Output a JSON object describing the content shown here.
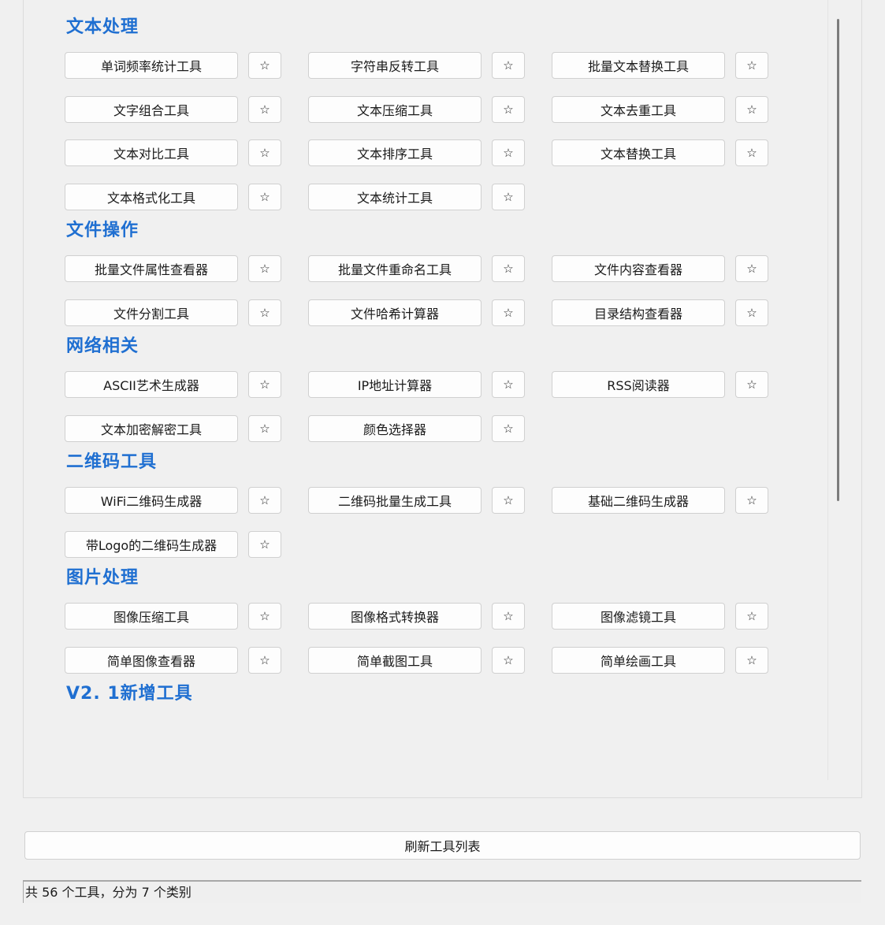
{
  "categories": [
    {
      "title": "文本处理",
      "tools": [
        "单词频率统计工具",
        "字符串反转工具",
        "批量文本替换工具",
        "文字组合工具",
        "文本压缩工具",
        "文本去重工具",
        "文本对比工具",
        "文本排序工具",
        "文本替换工具",
        "文本格式化工具",
        "文本统计工具"
      ]
    },
    {
      "title": "文件操作",
      "tools": [
        "批量文件属性查看器",
        "批量文件重命名工具",
        "文件内容查看器",
        "文件分割工具",
        "文件哈希计算器",
        "目录结构查看器"
      ]
    },
    {
      "title": "网络相关",
      "tools": [
        "ASCII艺术生成器",
        "IP地址计算器",
        "RSS阅读器",
        "文本加密解密工具",
        "颜色选择器"
      ]
    },
    {
      "title": "二维码工具",
      "tools": [
        "WiFi二维码生成器",
        "二维码批量生成工具",
        "基础二维码生成器",
        "带Logo的二维码生成器"
      ]
    },
    {
      "title": "图片处理",
      "tools": [
        "图像压缩工具",
        "图像格式转换器",
        "图像滤镜工具",
        "简单图像查看器",
        "简单截图工具",
        "简单绘画工具"
      ]
    },
    {
      "title": "V2. 1新增工具",
      "tools": []
    }
  ],
  "star_icon": "☆",
  "refresh_label": "刷新工具列表",
  "status_text": "共 56 个工具，分为 7 个类别"
}
